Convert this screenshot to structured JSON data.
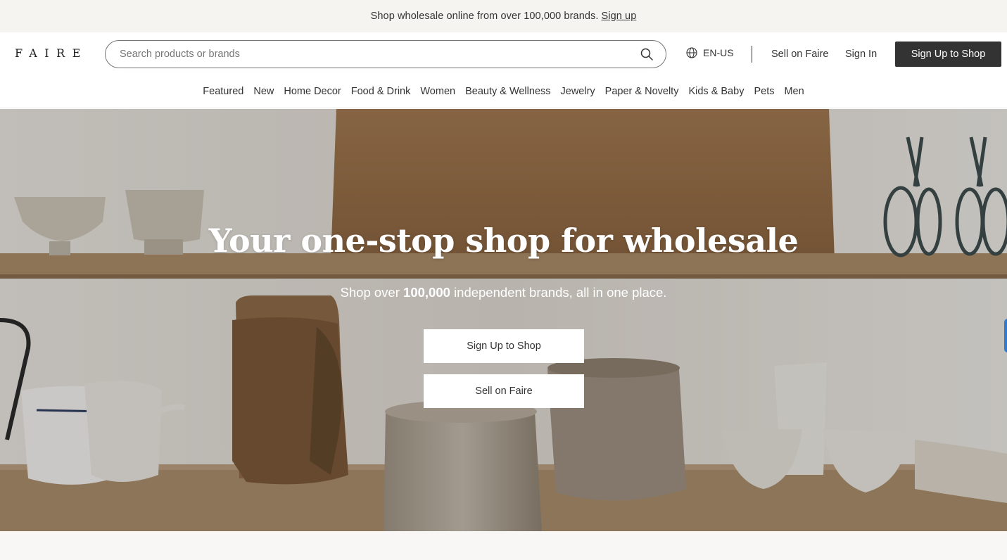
{
  "promo": {
    "text": "Shop wholesale online from over 100,000 brands.",
    "link": "Sign up"
  },
  "header": {
    "logo": "FAIRE",
    "search_placeholder": "Search products or brands",
    "language": "EN-US",
    "sell_link": "Sell on Faire",
    "signin_link": "Sign In",
    "signup_button": "Sign Up to Shop"
  },
  "categories": [
    "Featured",
    "New",
    "Home Decor",
    "Food & Drink",
    "Women",
    "Beauty & Wellness",
    "Jewelry",
    "Paper & Novelty",
    "Kids & Baby",
    "Pets",
    "Men"
  ],
  "hero": {
    "title": "Your one-stop shop for wholesale",
    "subtitle_pre": "Shop over ",
    "subtitle_bold": "100,000",
    "subtitle_post": " independent brands, all in one place.",
    "primary_button": "Sign Up to Shop",
    "secondary_button": "Sell on Faire"
  },
  "colors": {
    "promo_bg": "#f5f4f1",
    "dark_button": "#333333",
    "text": "#333333",
    "side_tab": "#2f7ad3"
  },
  "icons": {
    "search": "search-icon",
    "language": "globe-icon"
  }
}
